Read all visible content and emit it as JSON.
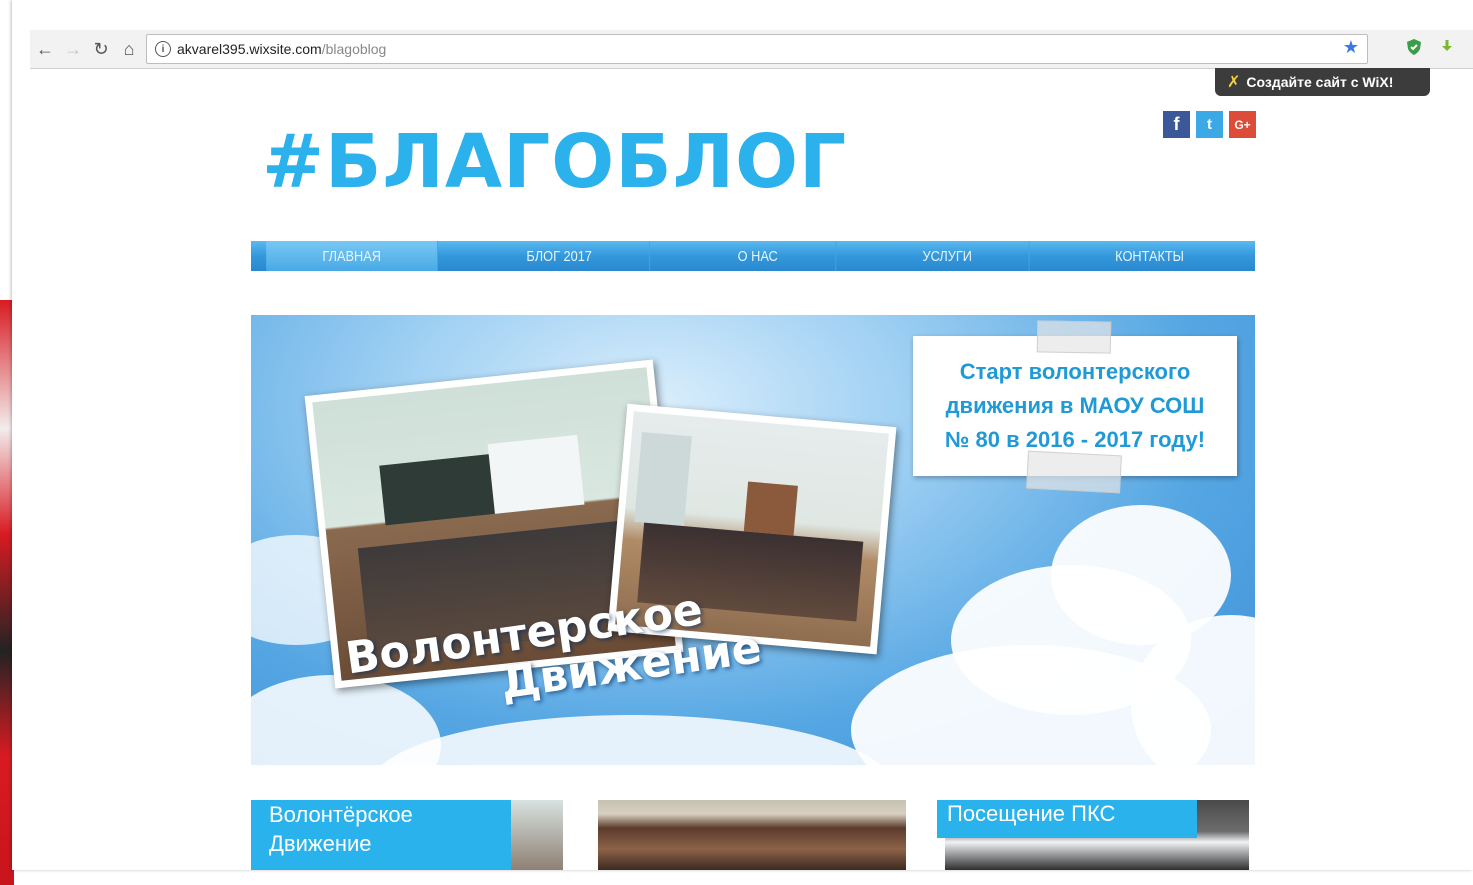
{
  "browser": {
    "url_host": "akvarel395.wixsite.com",
    "url_path": "/blagoblog"
  },
  "wix_banner": {
    "text": "Создайте сайт с WiX!"
  },
  "site": {
    "logo": "#БЛАГОБЛОГ",
    "social": {
      "facebook": "f",
      "twitter": "t",
      "google_plus": "G+"
    },
    "menu": [
      {
        "label": "ГЛАВНАЯ",
        "active": true
      },
      {
        "label": "БЛОГ 2017",
        "active": false
      },
      {
        "label": "О НАС",
        "active": false
      },
      {
        "label": "УСЛУГИ",
        "active": false
      },
      {
        "label": "КОНТАКТЫ",
        "active": false
      }
    ],
    "hero": {
      "announcement": "Старт волонтерского\nдвижения в МАОУ СОШ\n№ 80 в 2016 - 2017 году!",
      "title_line1": "Волонтерское",
      "title_line2": "Движение"
    },
    "cards": [
      {
        "label": "Волонтёрское\nДвижение"
      },
      {
        "label": ""
      },
      {
        "label": "Посещение ПКС"
      }
    ]
  },
  "colors": {
    "accent": "#2bb2ec",
    "menu": "#3398db",
    "wix_banner": "#3c3c3c"
  }
}
